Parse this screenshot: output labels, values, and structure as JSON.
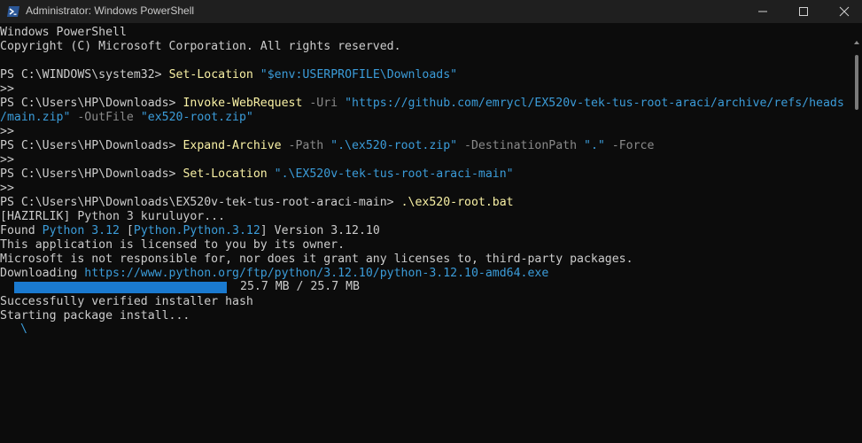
{
  "window": {
    "title": "Administrator: Windows PowerShell",
    "icon": "powershell-icon",
    "controls": [
      "minimize-icon",
      "maximize-icon",
      "close-icon"
    ]
  },
  "terminal": {
    "colors": {
      "background": "#0c0c0c",
      "text": "#cccccc",
      "command": "#f9f1a5",
      "string": "#3b9cd9",
      "parameter": "#8a8a8a",
      "progress": "#1a7ad0"
    },
    "lines": [
      [
        {
          "t": "Windows PowerShell",
          "c": "w"
        }
      ],
      [
        {
          "t": "Copyright (C) Microsoft Corporation. All rights reserved.",
          "c": "w"
        }
      ],
      [],
      [
        {
          "t": "PS C:\\WINDOWS\\system32> ",
          "c": "w"
        },
        {
          "t": "Set-Location",
          "c": "y"
        },
        {
          "t": " ",
          "c": "w"
        },
        {
          "t": "\"$env:USERPROFILE\\Downloads\"",
          "c": "b"
        }
      ],
      [
        {
          "t": ">>",
          "c": "w"
        }
      ],
      [
        {
          "t": "PS C:\\Users\\HP\\Downloads> ",
          "c": "w"
        },
        {
          "t": "Invoke-WebRequest",
          "c": "y"
        },
        {
          "t": " -Uri ",
          "c": "g"
        },
        {
          "t": "\"https://github.com/emrycl/EX520v-tek-tus-root-araci/archive/refs/heads",
          "c": "b"
        }
      ],
      [
        {
          "t": "/main.zip\"",
          "c": "b"
        },
        {
          "t": " -OutFile ",
          "c": "g"
        },
        {
          "t": "\"ex520-root.zip\"",
          "c": "b"
        }
      ],
      [
        {
          "t": ">>",
          "c": "w"
        }
      ],
      [
        {
          "t": "PS C:\\Users\\HP\\Downloads> ",
          "c": "w"
        },
        {
          "t": "Expand-Archive",
          "c": "y"
        },
        {
          "t": " -Path ",
          "c": "g"
        },
        {
          "t": "\".\\ex520-root.zip\"",
          "c": "b"
        },
        {
          "t": " -DestinationPath ",
          "c": "g"
        },
        {
          "t": "\".\"",
          "c": "b"
        },
        {
          "t": " -Force",
          "c": "g"
        }
      ],
      [
        {
          "t": ">>",
          "c": "w"
        }
      ],
      [
        {
          "t": "PS C:\\Users\\HP\\Downloads> ",
          "c": "w"
        },
        {
          "t": "Set-Location",
          "c": "y"
        },
        {
          "t": " ",
          "c": "w"
        },
        {
          "t": "\".\\EX520v-tek-tus-root-araci-main\"",
          "c": "b"
        }
      ],
      [
        {
          "t": ">>",
          "c": "w"
        }
      ],
      [
        {
          "t": "PS C:\\Users\\HP\\Downloads\\EX520v-tek-tus-root-araci-main> ",
          "c": "w"
        },
        {
          "t": ".\\ex520-root.bat",
          "c": "y"
        }
      ],
      [
        {
          "t": "[HAZIRLIK] Python 3 kuruluyor...",
          "c": "w"
        }
      ],
      [
        {
          "t": "Found ",
          "c": "w"
        },
        {
          "t": "Python 3.12",
          "c": "b"
        },
        {
          "t": " [",
          "c": "w"
        },
        {
          "t": "Python.Python.3.12",
          "c": "b"
        },
        {
          "t": "] Version 3.12.10",
          "c": "w"
        }
      ],
      [
        {
          "t": "This application is licensed to you by its owner.",
          "c": "w"
        }
      ],
      [
        {
          "t": "Microsoft is not responsible for, nor does it grant any licenses to, third-party packages.",
          "c": "w"
        }
      ],
      [
        {
          "t": "Downloading ",
          "c": "w"
        },
        {
          "t": "https://www.python.org/ftp/python/3.12.10/python-3.12.10-amd64.exe",
          "c": "b"
        }
      ],
      [],
      [
        {
          "t": "Successfully verified installer hash",
          "c": "w"
        }
      ],
      [
        {
          "t": "Starting package install...",
          "c": "w"
        }
      ]
    ],
    "progress": {
      "fraction": 1.0,
      "text": "25.7 MB / 25.7 MB"
    },
    "spinner": "\\"
  }
}
